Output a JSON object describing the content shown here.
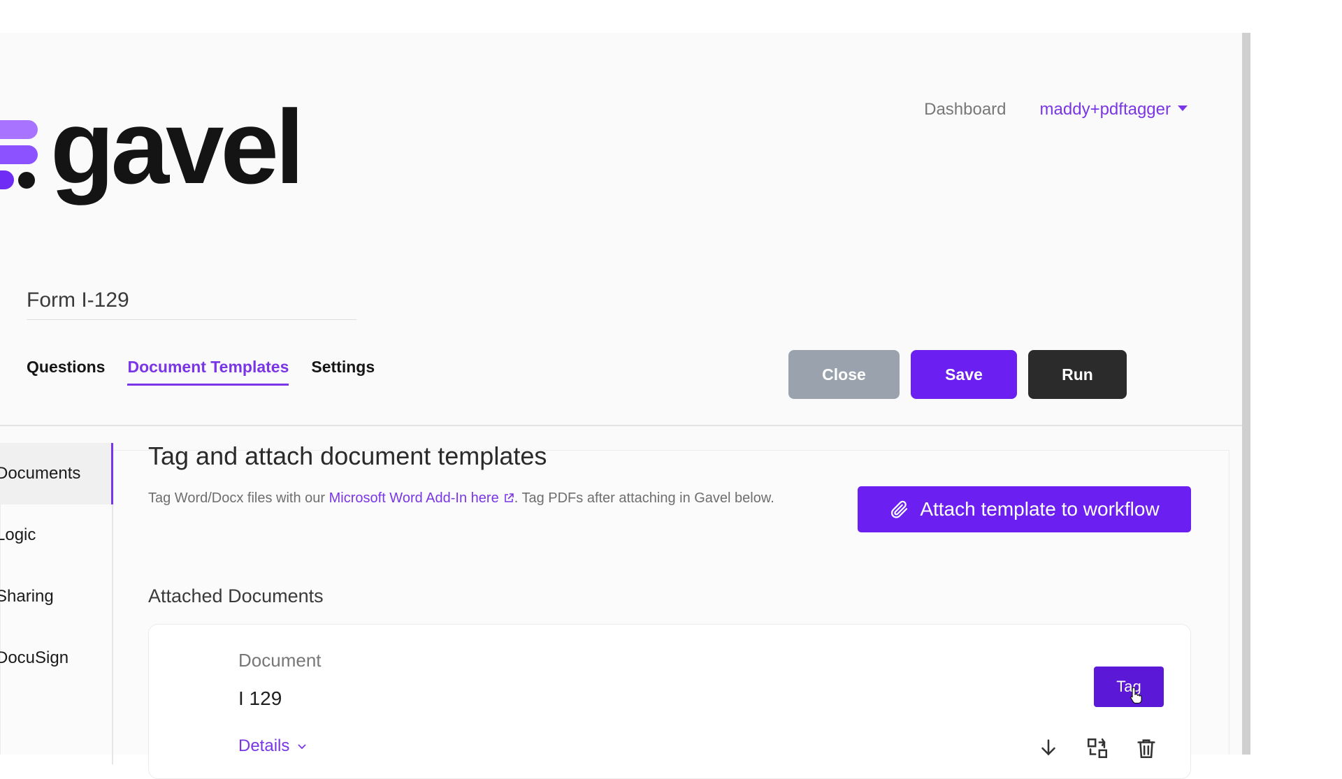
{
  "logo": {
    "text": "gavel"
  },
  "nav": {
    "dashboard": "Dashboard",
    "user": "maddy+pdftagger"
  },
  "form": {
    "title": "Form I-129"
  },
  "tabs": [
    {
      "label": "Questions"
    },
    {
      "label": "Document Templates"
    },
    {
      "label": "Settings"
    }
  ],
  "actions": {
    "close": "Close",
    "save": "Save",
    "run": "Run"
  },
  "sidebar": {
    "items": [
      {
        "label": "Documents"
      },
      {
        "label": "Logic"
      },
      {
        "label": "Sharing"
      },
      {
        "label": "DocuSign"
      }
    ]
  },
  "main": {
    "title": "Tag and attach document templates",
    "desc_prefix": "Tag Word/Docx files with our ",
    "desc_link": "Microsoft Word Add-In here",
    "desc_suffix": ". Tag PDFs after attaching in Gavel below.",
    "attach_button": "Attach template to workflow",
    "attached_title": "Attached Documents"
  },
  "document": {
    "label": "Document",
    "name": "I 129",
    "tag_button": "Tag",
    "details": "Details"
  },
  "colors": {
    "accent": "#6b1ff0",
    "link": "#7a36e6",
    "close_btn": "#9aa3ad",
    "run_btn": "#2b2b2b"
  }
}
